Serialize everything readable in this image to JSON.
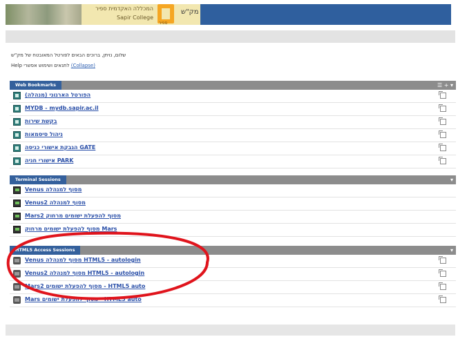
{
  "header": {
    "college_hebrew": "המכללה האקדמית ספיר",
    "college_english": "Sapir College",
    "logo_text": "ספיר",
    "portal_name": "מק\"ש"
  },
  "welcome": {
    "line1": "שלום, נויתן, ברוכים הבאים לפורטל המאובטח של מק\"ש",
    "line2_prefix": "Help לתנאים ושימוש אפשרי",
    "collapse": "(Collapse)"
  },
  "sections": [
    {
      "title": "Web Bookmarks",
      "icon": "bookmark-icon",
      "items": [
        "הפורטל הארגוני (מנהלה)",
        "MYDB - mydb.sapir.ac.il",
        "בקשת שירות",
        "ניהול סיסמאות",
        "הגבקת אישורי כניסה GATE",
        "אישורי חניה PARK"
      ]
    },
    {
      "title": "Terminal Sessions",
      "icon": "terminal-icon",
      "items": [
        "Venus מסוף למנהלה",
        "Venus2 מסוף למנהלה",
        "Mars2 מסוף להפעלת ישומים מרחוק",
        "מסוף להפעלת ישומים מרחוק Mars"
      ]
    },
    {
      "title": "HTML5 Access Sessions",
      "icon": "html5-session-icon",
      "items": [
        "Venus מסוף למנהלה HTML5 - autologin",
        "Venus2 מסוף למנהלה HTML5 - autologin",
        "Mars2 מסוף להפעלת ישומים - HTML5 auto",
        "Mars מסוף להפעלת ישומים - HTML5 auto"
      ]
    }
  ],
  "colors": {
    "header_blue": "#2f5f9e",
    "section_tab": "#34609c",
    "section_bar": "#8c8c8c",
    "link": "#2a4fa8",
    "annotation": "#e0141c"
  }
}
